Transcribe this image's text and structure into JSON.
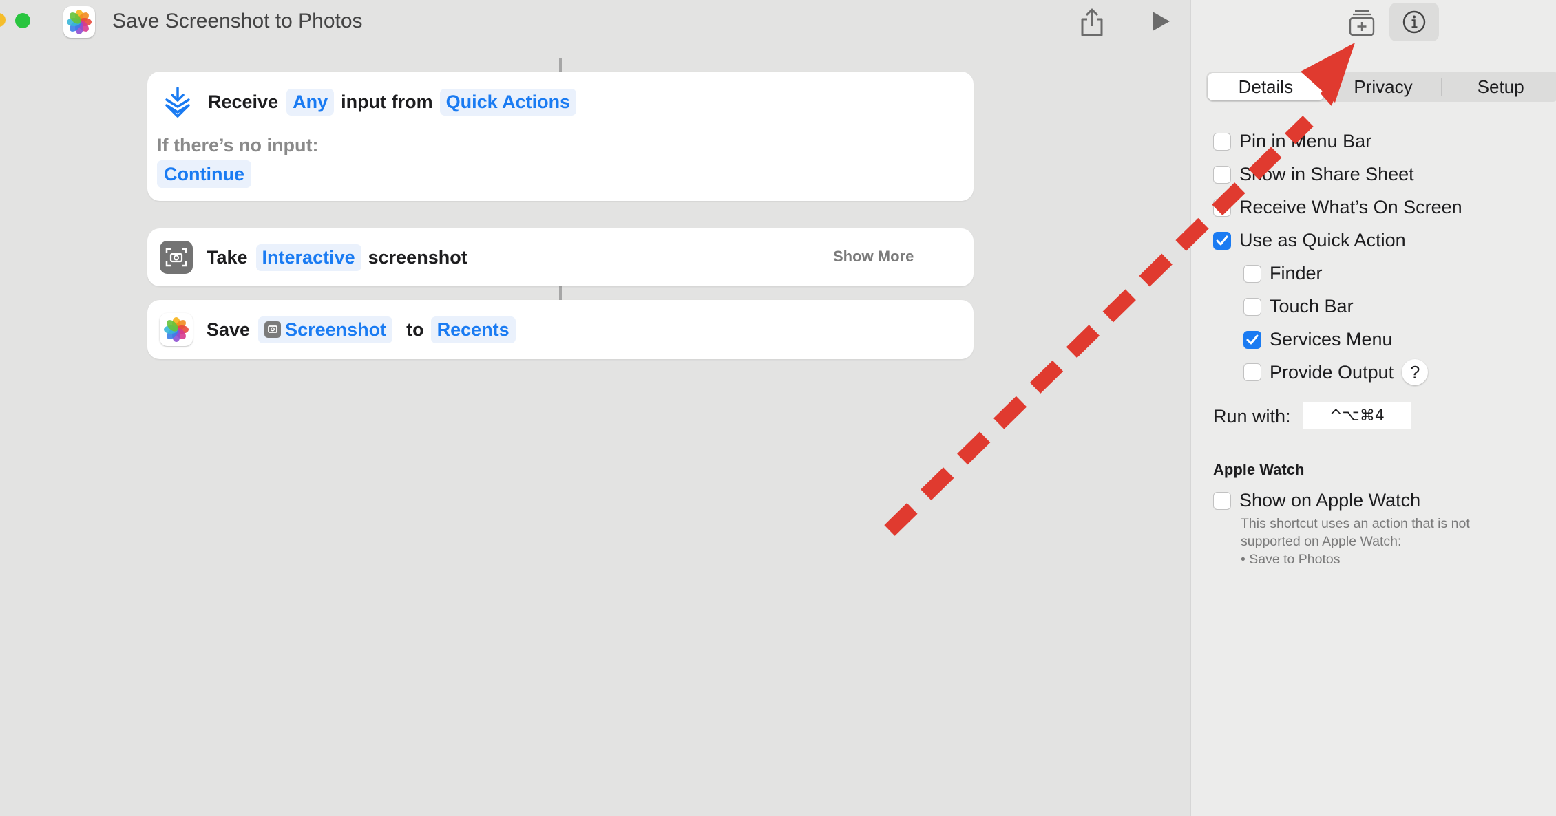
{
  "window": {
    "title": "Save Screenshot to Photos"
  },
  "colors": {
    "accent": "#1a7bf2",
    "canvas_bg": "#e3e3e2",
    "annotation_arrow": "#e03a2f"
  },
  "icons": {
    "app": "photos-icon",
    "share": "share-icon",
    "run": "play-icon",
    "library": "add-to-library-icon",
    "info": "info-icon",
    "receive": "quick-action-receive-icon",
    "screenshot": "screenshot-icon",
    "save": "photos-icon"
  },
  "editor": {
    "receive_action": {
      "verb": "Receive",
      "input_type": "Any",
      "middle": "input from",
      "source": "Quick Actions",
      "no_input_label": "If there’s no input:",
      "no_input_value": "Continue"
    },
    "screenshot_action": {
      "verb": "Take",
      "mode": "Interactive",
      "noun": "screenshot",
      "show_more": "Show More"
    },
    "save_action": {
      "verb": "Save",
      "variable": "Screenshot",
      "middle": "to",
      "album": "Recents"
    }
  },
  "inspector": {
    "tabs": [
      "Details",
      "Privacy",
      "Setup"
    ],
    "active_tab": "Details",
    "options": [
      {
        "label": "Pin in Menu Bar",
        "checked": false
      },
      {
        "label": "Show in Share Sheet",
        "checked": false
      },
      {
        "label": "Receive What’s On Screen",
        "checked": false
      },
      {
        "label": "Use as Quick Action",
        "checked": true
      }
    ],
    "quick_action_options": [
      {
        "label": "Finder",
        "checked": false
      },
      {
        "label": "Touch Bar",
        "checked": false
      },
      {
        "label": "Services Menu",
        "checked": true
      },
      {
        "label": "Provide Output",
        "checked": false
      }
    ],
    "help_glyph": "?",
    "run_with_label": "Run with:",
    "run_with_shortcut": "^⌥⌘4",
    "apple_watch": {
      "heading": "Apple Watch",
      "option_label": "Show on Apple Watch",
      "option_checked": false,
      "note_lines": [
        "This shortcut uses an action that is not",
        "supported on Apple Watch:",
        "• Save to Photos"
      ]
    }
  }
}
